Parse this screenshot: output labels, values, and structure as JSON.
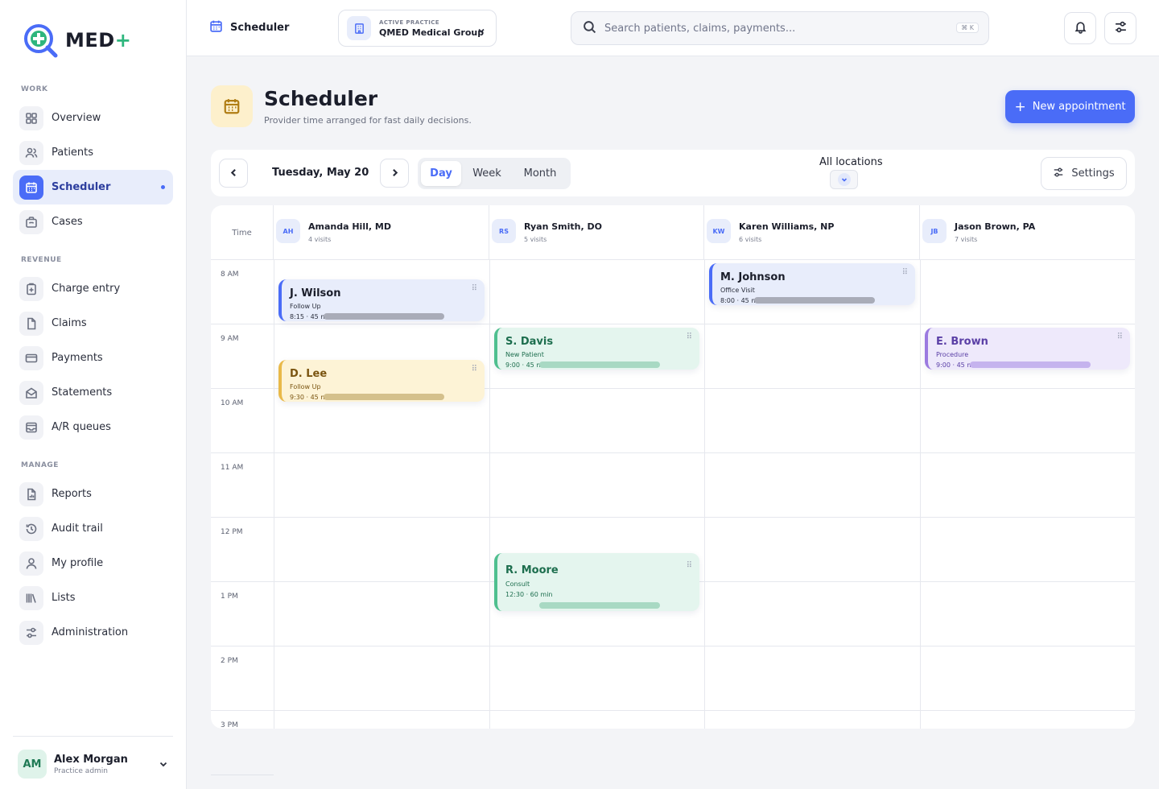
{
  "brand": {
    "name": "MED",
    "plus": "+"
  },
  "sidebar": {
    "sections": {
      "work": "WORK",
      "revenue": "REVENUE",
      "manage": "MANAGE"
    },
    "items": [
      {
        "label": "Overview",
        "icon": "grid-icon"
      },
      {
        "label": "Patients",
        "icon": "users-icon"
      },
      {
        "label": "Scheduler",
        "icon": "calendar-icon",
        "active": true
      },
      {
        "label": "Cases",
        "icon": "briefcase-icon"
      },
      {
        "label": "Charge entry",
        "icon": "clipboard-plus-icon"
      },
      {
        "label": "Claims",
        "icon": "file-icon"
      },
      {
        "label": "Payments",
        "icon": "card-icon"
      },
      {
        "label": "Statements",
        "icon": "envelope-icon"
      },
      {
        "label": "A/R queues",
        "icon": "inbox-icon"
      },
      {
        "label": "Reports",
        "icon": "report-icon"
      },
      {
        "label": "Audit trail",
        "icon": "history-icon"
      },
      {
        "label": "My profile",
        "icon": "user-icon"
      },
      {
        "label": "Lists",
        "icon": "library-icon"
      },
      {
        "label": "Administration",
        "icon": "sliders-icon"
      }
    ],
    "user": {
      "initials": "AM",
      "name": "Alex Morgan",
      "role": "Practice admin"
    }
  },
  "topbar": {
    "title": "Scheduler",
    "practice": {
      "kicker": "ACTIVE PRACTICE",
      "name": "QMED Medical Group"
    },
    "search": {
      "placeholder": "Search patients, claims, payments...",
      "shortcut": "⌘ K"
    }
  },
  "page": {
    "title": "Scheduler",
    "subtitle": "Provider time arranged for fast daily decisions.",
    "new_button": "New appointment"
  },
  "toolbar": {
    "date": "Tuesday, May 20",
    "views": [
      "Day",
      "Week",
      "Month"
    ],
    "active_view": "Day",
    "location": "All locations",
    "settings": "Settings"
  },
  "calendar": {
    "time_header": "Time",
    "providers": [
      {
        "initials": "AH",
        "name": "Amanda Hill, MD",
        "visits": "4 visits"
      },
      {
        "initials": "RS",
        "name": "Ryan Smith, DO",
        "visits": "5 visits"
      },
      {
        "initials": "KW",
        "name": "Karen Williams, NP",
        "visits": "6 visits"
      },
      {
        "initials": "JB",
        "name": "Jason Brown, PA",
        "visits": "7 visits"
      }
    ],
    "times": [
      "8 AM",
      "9 AM",
      "10 AM",
      "11 AM",
      "12 PM",
      "1 PM",
      "2 PM",
      "3 PM"
    ],
    "appointments": [
      {
        "patient": "J. Wilson",
        "type": "Follow Up",
        "meta": "8:15 · 45 min",
        "provider": 0,
        "color": "blue"
      },
      {
        "patient": "D. Lee",
        "type": "Follow Up",
        "meta": "9:30 · 45 min",
        "provider": 0,
        "color": "amber"
      },
      {
        "patient": "S. Davis",
        "type": "New Patient",
        "meta": "9:00 · 45 min",
        "provider": 1,
        "color": "green"
      },
      {
        "patient": "R. Moore",
        "type": "Consult",
        "meta": "12:30 · 60 min",
        "provider": 1,
        "color": "green"
      },
      {
        "patient": "M. Johnson",
        "type": "Office Visit",
        "meta": "8:00 · 45 min",
        "provider": 2,
        "color": "blue"
      },
      {
        "patient": "E. Brown",
        "type": "Procedure",
        "meta": "9:00 · 45 min",
        "provider": 3,
        "color": "purple"
      }
    ]
  },
  "colors": {
    "accent": "#4a6cf7",
    "brand_plus": "#2eb67d"
  }
}
